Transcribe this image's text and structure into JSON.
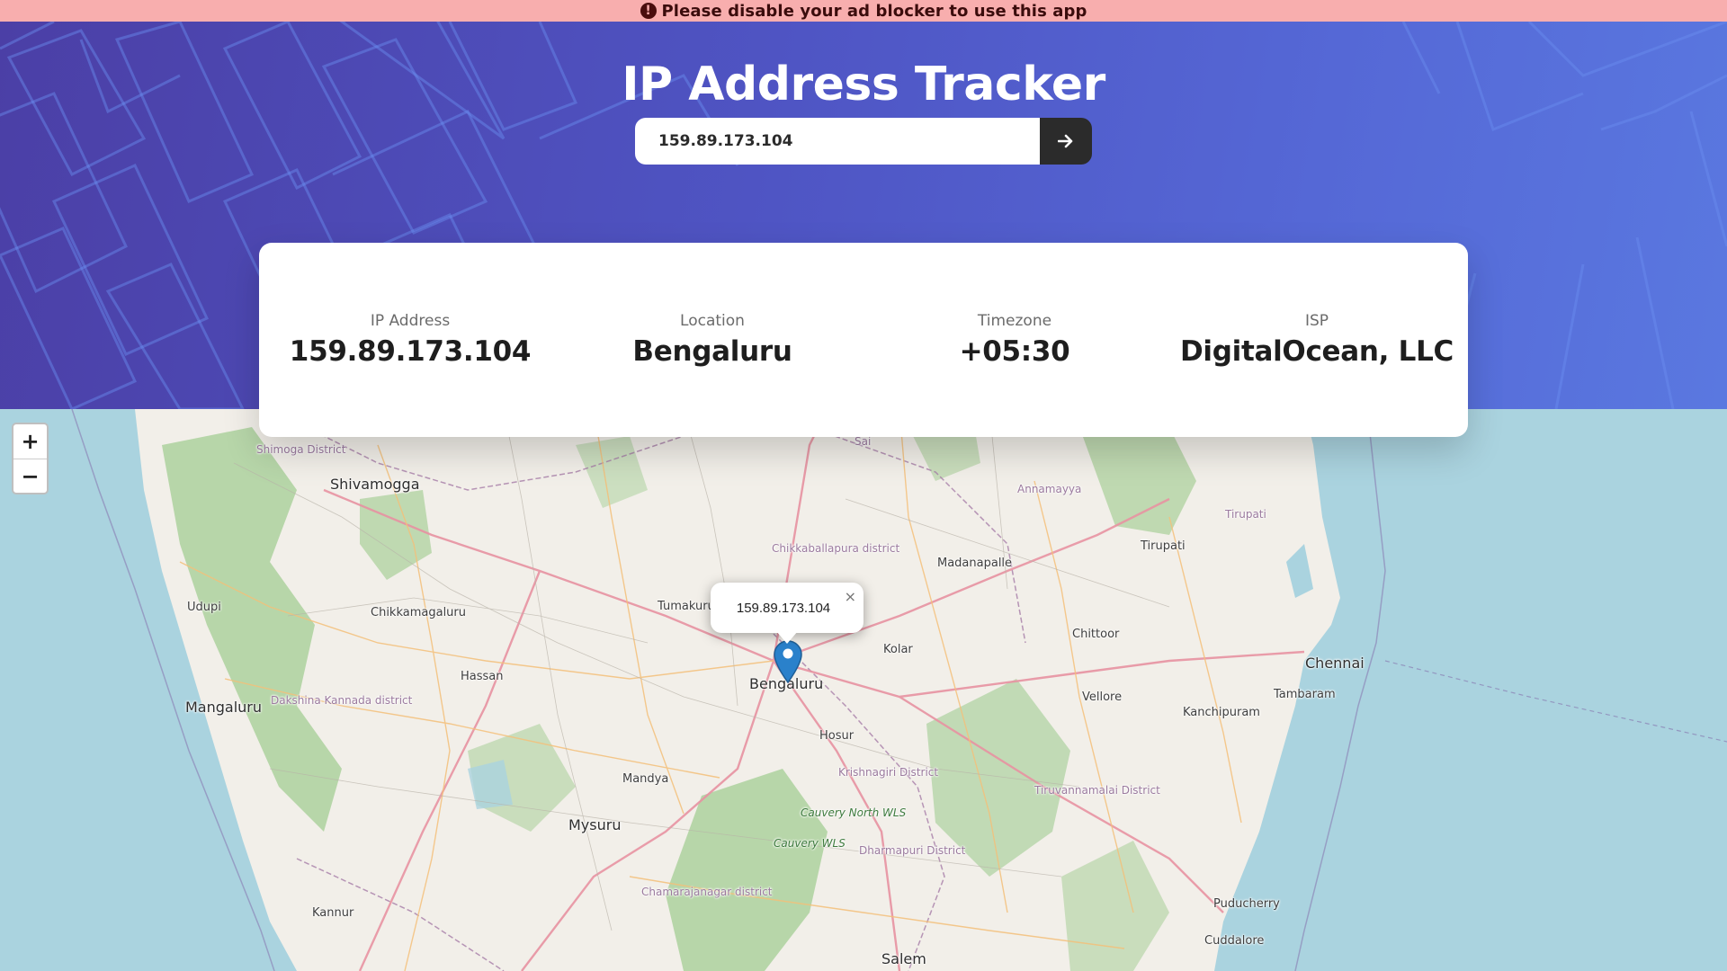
{
  "banner": {
    "icon": "exclamation-circle-icon",
    "text": "Please disable your ad blocker to use this app"
  },
  "header": {
    "title": "IP Address Tracker"
  },
  "search": {
    "value": "159.89.173.104",
    "button_icon": "arrow-right-icon"
  },
  "info": {
    "ip_label": "IP Address",
    "ip_value": "159.89.173.104",
    "location_label": "Location",
    "location_value": "Bengaluru",
    "timezone_label": "Timezone",
    "timezone_value": "+05:30",
    "isp_label": "ISP",
    "isp_value": "DigitalOcean, LLC"
  },
  "map": {
    "zoom_in": "+",
    "zoom_out": "−",
    "popup_text": "159.89.173.104",
    "popup_close": "×",
    "labels": {
      "shimoga_district": "Shimoga District",
      "shivamogga": "Shivamogga",
      "udupi": "Udupi",
      "chikkamagaluru": "Chikkamagaluru",
      "mangaluru": "Mangaluru",
      "dakshina_kannada": "Dakshina Kannada district",
      "hassan": "Hassan",
      "tumakuru": "Tumakuru",
      "chikkaballapura": "Chikkaballapura district",
      "madanapalle": "Madanapalle",
      "annamayya": "Annamayya",
      "tirupati": "Tirupati",
      "tirupati_district": "Tirupati",
      "sai": "Sai",
      "kolar": "Kolar",
      "bengaluru": "Bengaluru",
      "chittoor": "Chittoor",
      "chennai": "Chennai",
      "tambaram": "Tambaram",
      "vellore": "Vellore",
      "kanchipuram": "Kanchipuram",
      "hosur": "Hosur",
      "mandya": "Mandya",
      "krishnagiri": "Krishnagiri District",
      "mysuru": "Mysuru",
      "cauvery_north": "Cauvery North WLS",
      "cauvery_wls": "Cauvery WLS",
      "tiruvannamalai": "Tiruvannamalai District",
      "dharmapuri": "Dharmapuri District",
      "chamarajanagar": "Chamarajanagar district",
      "kannur": "Kannur",
      "puducherry": "Puducherry",
      "cuddalore": "Cuddalore",
      "salem": "Salem"
    }
  },
  "colors": {
    "banner_bg": "#f8aeae",
    "header_gradient_start": "#4b3fa6",
    "header_gradient_end": "#5a78e0",
    "search_button": "#2b2b2b",
    "sea": "#aad3df",
    "land": "#f2efe9",
    "forest": "#add19e",
    "marker": "#2a81cb"
  }
}
